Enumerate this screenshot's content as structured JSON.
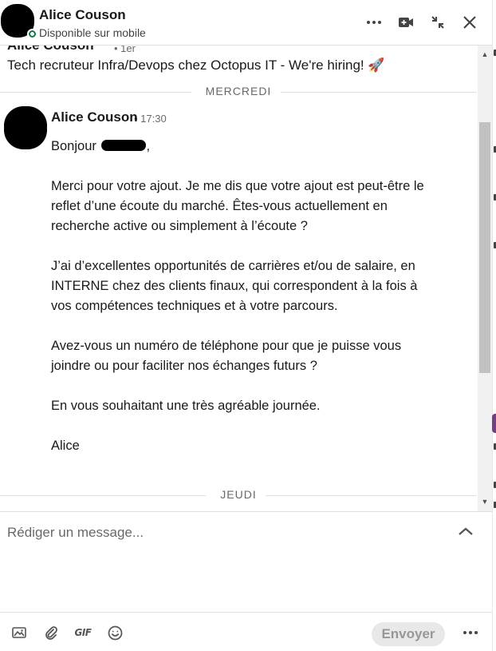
{
  "header": {
    "name": "Alice Couson",
    "status": "Disponible sur mobile"
  },
  "previous_message": {
    "sender": "Alice Couson",
    "time": "• 1er",
    "text": "Tech recruteur Infra/Devops chez Octopus IT - We're hiring! 🚀"
  },
  "dividers": {
    "wednesday": "MERCREDI",
    "thursday": "JEUDI"
  },
  "message": {
    "sender": "Alice Couson",
    "time": "• 17:30",
    "greeting": "Bonjour",
    "greeting_suffix": ",",
    "paragraphs": [
      "Merci pour votre ajout. Je me dis que votre ajout est peut-être le reflet d’une écoute du marché. Êtes-vous actuellement en recherche active ou simplement à l’écoute ?",
      "J’ai d’excellentes opportunités de carrières et/ou de salaire, en INTERNE chez des clients finaux, qui correspondent à la fois à vos compétences techniques et à votre parcours.",
      "Avez-vous un numéro de téléphone pour que je puisse vous joindre ou pour faciliter nos échanges futurs ?",
      "En vous souhaitant une très agréable journée.",
      "Alice"
    ]
  },
  "compose": {
    "placeholder": "Rédiger un message..."
  },
  "footer": {
    "gif_label": "GIF",
    "send_label": "Envoyer"
  },
  "colors": {
    "online": "#057642",
    "scroll_thumb": "#c1c1c1",
    "send_disabled_bg": "#e8e8e8"
  }
}
